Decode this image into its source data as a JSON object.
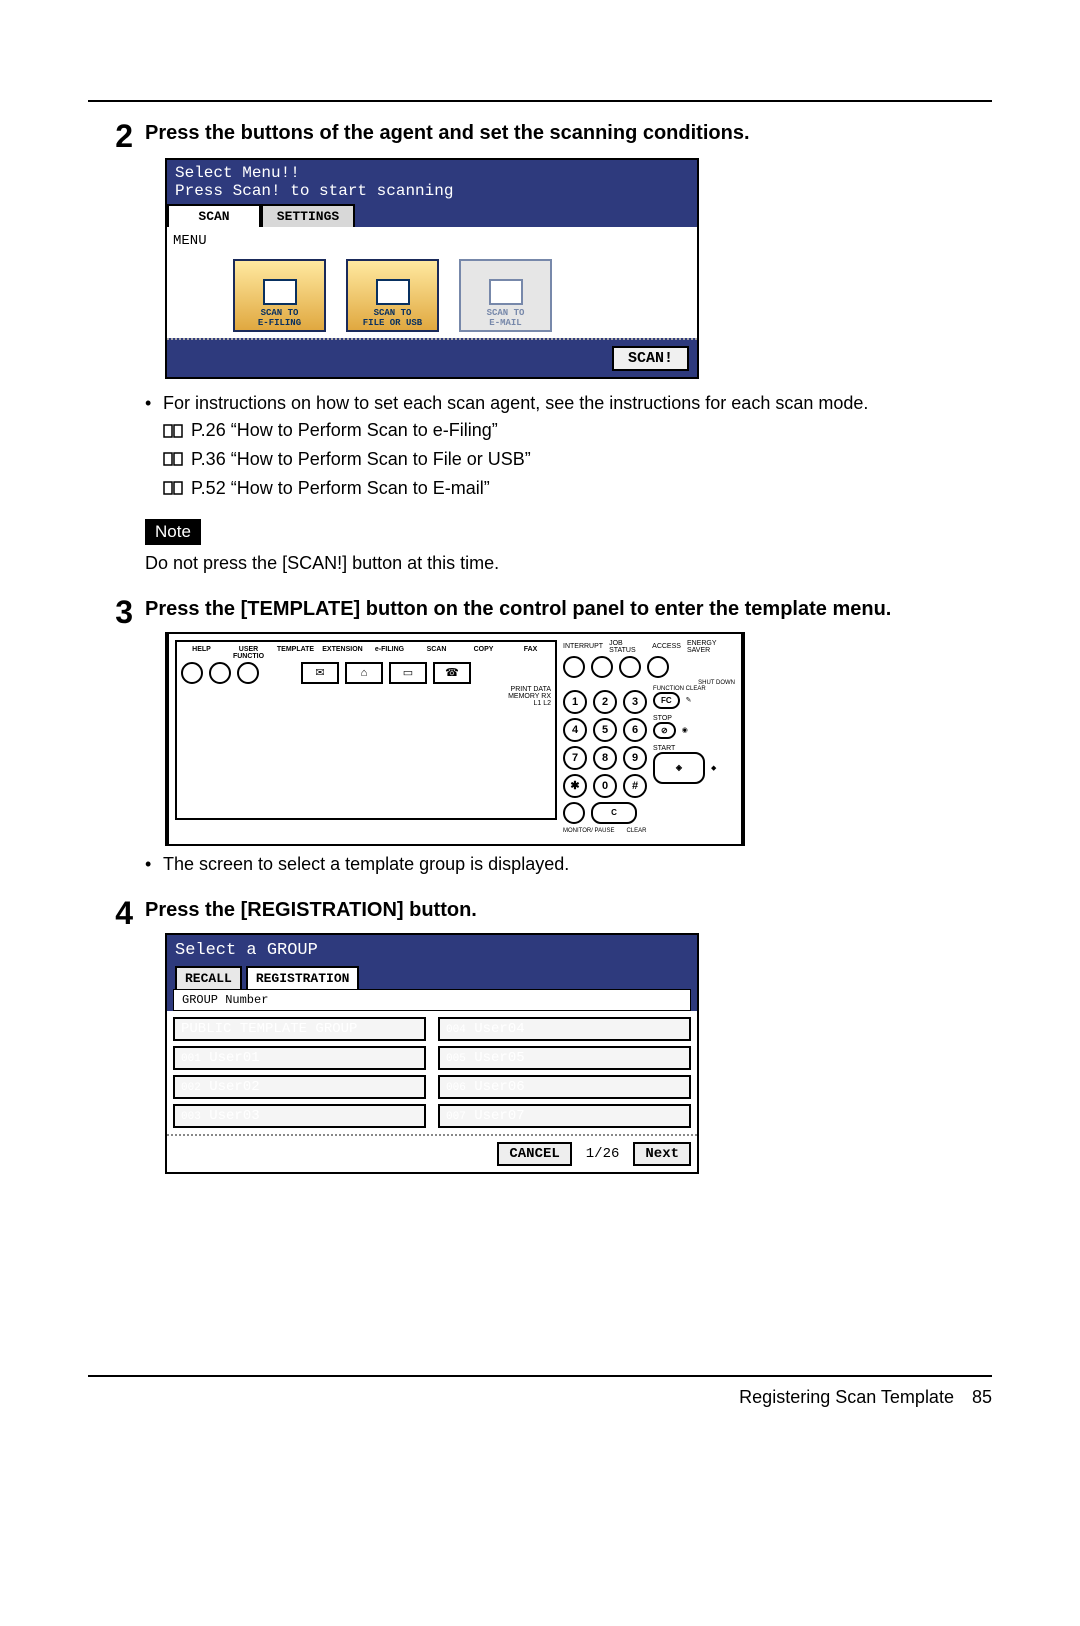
{
  "steps": {
    "s2": {
      "num": "2",
      "heading": "Press the buttons of the agent and set the scanning conditions.",
      "bullet1": "For instructions on how to set each scan agent, see the instructions for each scan mode.",
      "ref1": "P.26 “How to Perform Scan to e-Filing”",
      "ref2": "P.36 “How to Perform Scan to File or USB”",
      "ref3": "P.52 “How to Perform Scan to E-mail”",
      "noteLabel": "Note",
      "noteText": "Do not press the [SCAN!] button at this time."
    },
    "s3": {
      "num": "3",
      "heading": "Press the [TEMPLATE] button on the control panel to enter the template menu.",
      "bullet1": "The screen to select a template group is displayed."
    },
    "s4": {
      "num": "4",
      "heading": "Press the [REGISTRATION] button."
    }
  },
  "scanScreen": {
    "title1": "Select Menu!!",
    "title2": "Press Scan! to start scanning",
    "tabScan": "SCAN",
    "tabSettings": "SETTINGS",
    "menuLabel": "MENU",
    "icon1a": "SCAN TO",
    "icon1b": "E-FILING",
    "icon2a": "SCAN TO",
    "icon2b": "FILE OR USB",
    "icon3a": "SCAN TO",
    "icon3b": "E-MAIL",
    "scanBtn": "SCAN!"
  },
  "controlPanel": {
    "labels": {
      "help": "HELP",
      "userFunc": "USER FUNCTIO",
      "template": "TEMPLATE",
      "extension": "EXTENSION",
      "efiling": "e-FILING",
      "scan": "SCAN",
      "copy": "COPY",
      "fax": "FAX",
      "printData": "PRINT DATA",
      "memoryRx": "MEMORY RX",
      "l1l2": "L1   L2",
      "interrupt": "INTERRUPT",
      "jobStatus": "JOB STATUS",
      "access": "ACCESS",
      "energySaver": "ENERGY SAVER",
      "shutDown": "SHUT DOWN",
      "functionClear": "FUNCTION CLEAR",
      "fc": "FC",
      "stop": "STOP",
      "start": "START",
      "monitorPause": "MONITOR/ PAUSE",
      "clear": "CLEAR",
      "c": "C"
    },
    "keys": {
      "k1": "1",
      "k2": "2",
      "k3": "3",
      "k4": "4",
      "k5": "5",
      "k6": "6",
      "k7": "7",
      "k8": "8",
      "k9": "9",
      "kStar": "✱",
      "k0": "0",
      "kHash": "#"
    }
  },
  "groupScreen": {
    "title": "Select a GROUP",
    "tabRecall": "RECALL",
    "tabRegistration": "REGISTRATION",
    "subLabel": "GROUP Number",
    "left": [
      {
        "idx": "",
        "label": "PUBLIC TEMPLATE GROUP"
      },
      {
        "idx": "001",
        "label": "User01"
      },
      {
        "idx": "002",
        "label": "User02"
      },
      {
        "idx": "003",
        "label": "User03"
      }
    ],
    "right": [
      {
        "idx": "004",
        "label": "User04"
      },
      {
        "idx": "005",
        "label": "User05"
      },
      {
        "idx": "006",
        "label": "User06"
      },
      {
        "idx": "007",
        "label": "User07"
      }
    ],
    "cancel": "CANCEL",
    "pager": "1/26",
    "next": "Next"
  },
  "footer": {
    "title": "Registering Scan Template",
    "page": "85"
  }
}
